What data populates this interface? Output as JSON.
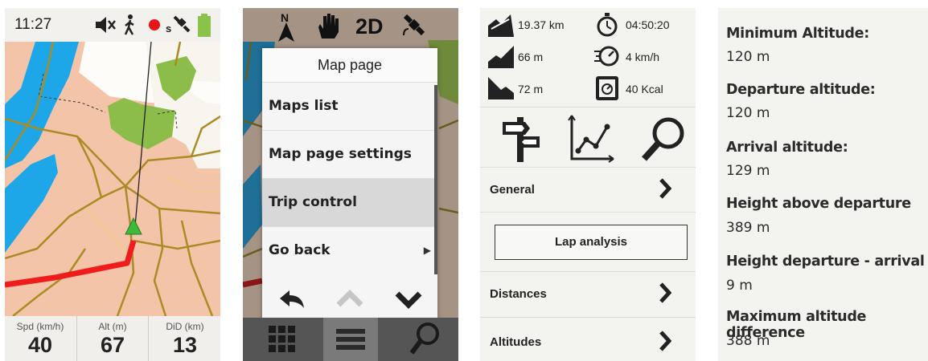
{
  "panel1": {
    "status": {
      "time": "11:27",
      "icons": [
        "mute-icon",
        "hiker-icon",
        "record-dot-icon",
        "satellite-icon",
        "battery-icon"
      ],
      "satellite_letter": "s"
    },
    "bottom": [
      {
        "label": "Spd (km/h)",
        "value": "40"
      },
      {
        "label": "Alt (m)",
        "value": "67"
      },
      {
        "label": "DiD (km)",
        "value": "13"
      }
    ]
  },
  "panel2": {
    "top_icons": {
      "north_letter": "N",
      "mode": "2D"
    },
    "menu": {
      "title": "Map page",
      "items": [
        {
          "label": "Maps list"
        },
        {
          "label": "Map page settings"
        },
        {
          "label": "Trip control"
        },
        {
          "label": "Go back"
        }
      ],
      "selected_index": 2
    }
  },
  "panel3": {
    "stats": {
      "distance": "19.37 km",
      "time": "04:50:20",
      "ascent": "66 m",
      "speed": "4 km/h",
      "descent": "72 m",
      "calories": "40 Kcal"
    },
    "rows": {
      "general": "General",
      "lap_analysis": "Lap analysis",
      "distances": "Distances",
      "altitudes": "Altitudes"
    }
  },
  "panel4": {
    "items": [
      {
        "label": "Minimum Altitude:",
        "value": "120 m"
      },
      {
        "label": "Departure altitude:",
        "value": "120 m"
      },
      {
        "label": "Arrival altitude:",
        "value": "129 m"
      },
      {
        "label": "Height above departure",
        "value": "389 m"
      },
      {
        "label": "Height departure - arrival",
        "value": "9 m"
      },
      {
        "label": "Maximum altitude difference",
        "value": "388 m"
      }
    ]
  },
  "colors": {
    "map_land": "#f4c4a8",
    "map_water": "#1da7e8",
    "map_park": "#8cbc4a",
    "map_road": "#c8a732",
    "route": "#ee1c1c",
    "menu_selected": "#d8d8d8",
    "record": "#e8141c",
    "battery": "#8bc34a"
  }
}
